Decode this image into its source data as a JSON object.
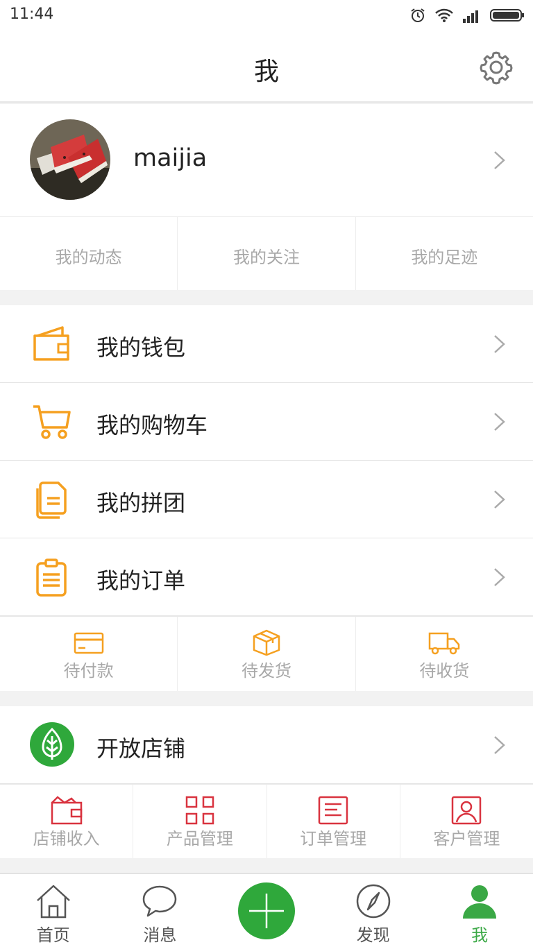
{
  "status": {
    "time": "11:44"
  },
  "header": {
    "title": "我"
  },
  "profile": {
    "username": "maijia"
  },
  "quick_links": [
    {
      "label": "我的动态"
    },
    {
      "label": "我的关注"
    },
    {
      "label": "我的足迹"
    }
  ],
  "menu": [
    {
      "label": "我的钱包",
      "icon": "wallet-icon"
    },
    {
      "label": "我的购物车",
      "icon": "cart-icon"
    },
    {
      "label": "我的拼团",
      "icon": "group-buy-icon"
    },
    {
      "label": "我的订单",
      "icon": "order-clipboard-icon"
    }
  ],
  "order_status": [
    {
      "label": "待付款",
      "icon": "card-icon"
    },
    {
      "label": "待发货",
      "icon": "package-icon"
    },
    {
      "label": "待收货",
      "icon": "truck-icon"
    }
  ],
  "store": {
    "label": "开放店铺",
    "icon": "tree-icon"
  },
  "store_tools": [
    {
      "label": "店铺收入",
      "icon": "income-icon"
    },
    {
      "label": "产品管理",
      "icon": "grid-icon"
    },
    {
      "label": "订单管理",
      "icon": "list-icon"
    },
    {
      "label": "客户管理",
      "icon": "customer-icon"
    }
  ],
  "tabs": [
    {
      "label": "首页",
      "icon": "home-icon"
    },
    {
      "label": "消息",
      "icon": "chat-icon"
    },
    {
      "label": "",
      "icon": "plus-icon"
    },
    {
      "label": "发现",
      "icon": "compass-icon"
    },
    {
      "label": "我",
      "icon": "user-icon",
      "active": true
    }
  ],
  "colors": {
    "accent_orange": "#f5a020",
    "accent_green": "#2fa83b",
    "accent_red": "#d9333f"
  }
}
